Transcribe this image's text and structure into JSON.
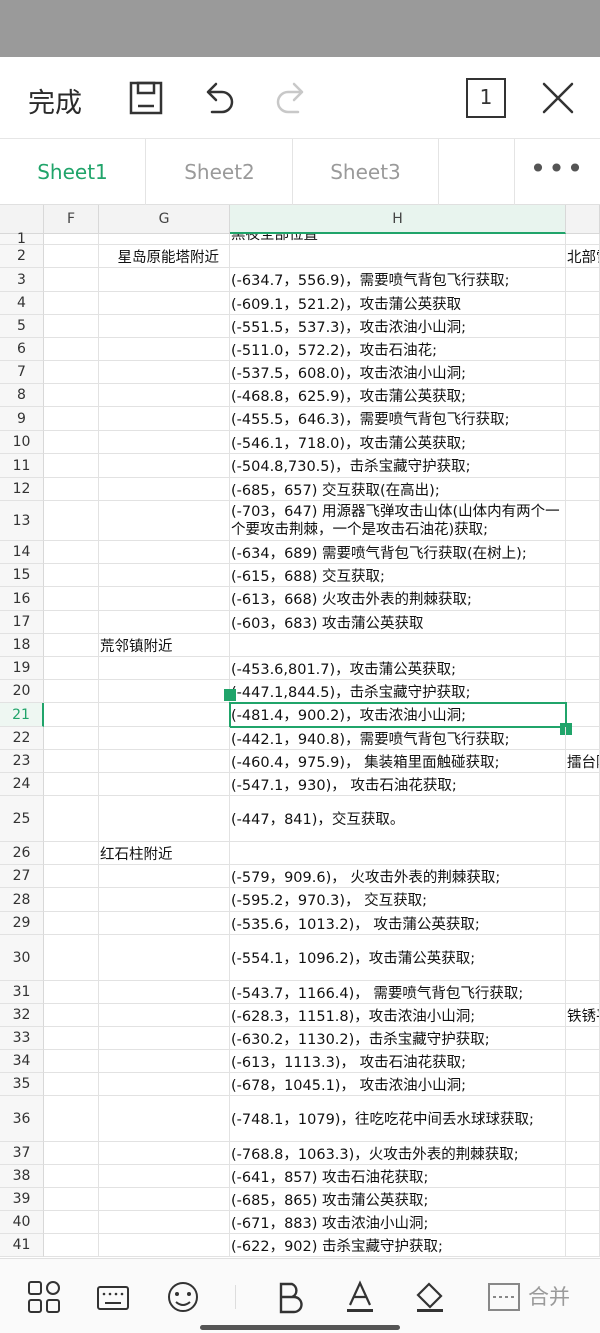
{
  "toolbar": {
    "done_label": "完成",
    "page_count": "1",
    "icons": [
      "save-icon",
      "undo-icon",
      "redo-icon",
      "page-count-icon",
      "close-icon"
    ]
  },
  "sheets": {
    "tabs": [
      "Sheet1",
      "Sheet2",
      "Sheet3"
    ],
    "active": "Sheet1",
    "more": "•••"
  },
  "columns": [
    "F",
    "G",
    "H"
  ],
  "selected_column": "H",
  "selected_row": "21",
  "accent": "#20a46a",
  "rows": [
    {
      "n": "1",
      "g": "",
      "h": "黑夜全部位置",
      "i": ""
    },
    {
      "n": "2",
      "g": "星岛原能塔附近",
      "h": "",
      "i": "北部雪"
    },
    {
      "n": "3",
      "g": "",
      "h": "(-634.7，556.9)，需要喷气背包飞行获取;",
      "i": ""
    },
    {
      "n": "4",
      "g": "",
      "h": "(-609.1，521.2)，攻击蒲公英获取",
      "i": ""
    },
    {
      "n": "5",
      "g": "",
      "h": "(-551.5，537.3)，攻击浓油小山洞;",
      "i": ""
    },
    {
      "n": "6",
      "g": "",
      "h": "(-511.0，572.2)，攻击石油花;",
      "i": ""
    },
    {
      "n": "7",
      "g": "",
      "h": "(-537.5，608.0)，攻击浓油小山洞;",
      "i": ""
    },
    {
      "n": "8",
      "g": "",
      "h": "(-468.8，625.9)，攻击蒲公英获取;",
      "i": ""
    },
    {
      "n": "9",
      "g": "",
      "h": "(-455.5，646.3)，需要喷气背包飞行获取;",
      "i": ""
    },
    {
      "n": "10",
      "g": "",
      "h": "(-546.1，718.0)，攻击蒲公英获取;",
      "i": ""
    },
    {
      "n": "11",
      "g": "",
      "h": "(-504.8,730.5)，击杀宝藏守护获取;",
      "i": ""
    },
    {
      "n": "12",
      "g": "",
      "h": "(-685，657) 交互获取(在高出);",
      "i": ""
    },
    {
      "n": "13",
      "g": "",
      "h": "(-703，647) 用源器飞弹攻击山体(山体内有两个一个要攻击荆棘，一个是攻击石油花)获取;",
      "i": ""
    },
    {
      "n": "14",
      "g": "",
      "h": "(-634，689) 需要喷气背包飞行获取(在树上);",
      "i": ""
    },
    {
      "n": "15",
      "g": "",
      "h": "(-615，688) 交互获取;",
      "i": ""
    },
    {
      "n": "16",
      "g": "",
      "h": "(-613，668) 火攻击外表的荆棘获取;",
      "i": ""
    },
    {
      "n": "17",
      "g": "",
      "h": "(-603，683) 攻击蒲公英获取",
      "i": ""
    },
    {
      "n": "18",
      "g": "荒邻镇附近",
      "h": "",
      "i": ""
    },
    {
      "n": "19",
      "g": "",
      "h": "(-453.6,801.7)，攻击蒲公英获取;",
      "i": ""
    },
    {
      "n": "20",
      "g": "",
      "h": "(-447.1,844.5)，击杀宝藏守护获取;",
      "i": ""
    },
    {
      "n": "21",
      "g": "",
      "h": "(-481.4，900.2)，攻击浓油小山洞;",
      "i": ""
    },
    {
      "n": "22",
      "g": "",
      "h": "(-442.1，940.8)，需要喷气背包飞行获取;",
      "i": ""
    },
    {
      "n": "23",
      "g": "",
      "h": "(-460.4，975.9)，  集装箱里面触碰获取;",
      "i": "擂台附"
    },
    {
      "n": "24",
      "g": "",
      "h": "(-547.1，930)，  攻击石油花获取;",
      "i": ""
    },
    {
      "n": "25",
      "g": "",
      "h": "(-447，841)，交互获取。",
      "i": ""
    },
    {
      "n": "26",
      "g": "红石柱附近",
      "h": "",
      "i": ""
    },
    {
      "n": "27",
      "g": "",
      "h": "(-579，909.6)，  火攻击外表的荆棘获取;",
      "i": ""
    },
    {
      "n": "28",
      "g": "",
      "h": "(-595.2，970.3)，  交互获取;",
      "i": ""
    },
    {
      "n": "29",
      "g": "",
      "h": "(-535.6，1013.2)，  攻击蒲公英获取;",
      "i": ""
    },
    {
      "n": "30",
      "g": "",
      "h": "(-554.1，1096.2)，攻击蒲公英获取;",
      "i": ""
    },
    {
      "n": "31",
      "g": "",
      "h": "(-543.7，1166.4)，  需要喷气背包飞行获取;",
      "i": ""
    },
    {
      "n": "32",
      "g": "",
      "h": "(-628.3，1151.8)，攻击浓油小山洞;",
      "i": "铁锈平"
    },
    {
      "n": "33",
      "g": "",
      "h": "(-630.2，1130.2)，击杀宝藏守护获取;",
      "i": ""
    },
    {
      "n": "34",
      "g": "",
      "h": "(-613，1113.3)，  攻击石油花获取;",
      "i": ""
    },
    {
      "n": "35",
      "g": "",
      "h": "(-678，1045.1)，  攻击浓油小山洞;",
      "i": ""
    },
    {
      "n": "36",
      "g": "",
      "h": "(-748.1，1079)，往吃吃花中间丢水球球获取;",
      "i": ""
    },
    {
      "n": "37",
      "g": "",
      "h": "(-768.8，1063.3)，火攻击外表的荆棘获取;",
      "i": ""
    },
    {
      "n": "38",
      "g": "",
      "h": "(-641，857) 攻击石油花获取;",
      "i": ""
    },
    {
      "n": "39",
      "g": "",
      "h": "(-685，865) 攻击蒲公英获取;",
      "i": ""
    },
    {
      "n": "40",
      "g": "",
      "h": "(-671，883) 攻击浓油小山洞;",
      "i": ""
    },
    {
      "n": "41",
      "g": "",
      "h": "(-622，902) 击杀宝藏守护获取;",
      "i": ""
    }
  ],
  "bottombar": {
    "merge_label": "合并",
    "icons": [
      "apps-icon",
      "keyboard-icon",
      "emoji-icon",
      "bold-icon",
      "font-color-icon",
      "fill-color-icon",
      "merge-cells-icon"
    ]
  }
}
